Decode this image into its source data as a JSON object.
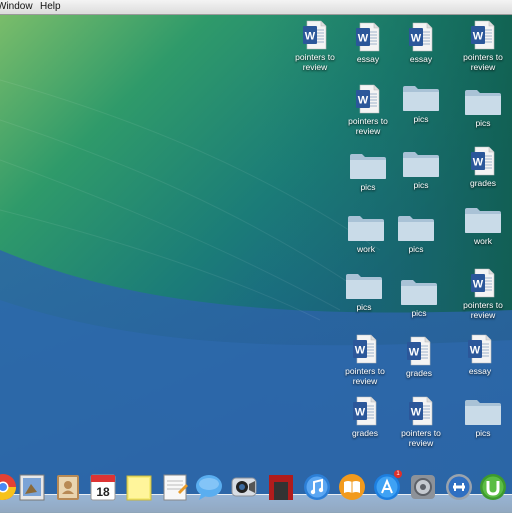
{
  "menubar": {
    "items": [
      "Window",
      "Help"
    ],
    "visible_items": [
      "Window",
      "Help"
    ]
  },
  "desktop": {
    "icons": [
      {
        "type": "word",
        "label": "pointers to review"
      },
      {
        "type": "word",
        "label": "essay"
      },
      {
        "type": "word",
        "label": "essay"
      },
      {
        "type": "word",
        "label": "pointers to review"
      },
      {
        "type": "word",
        "label": "pointers to review"
      },
      {
        "type": "folder",
        "label": "pics"
      },
      {
        "type": "folder",
        "label": "pics"
      },
      {
        "type": "folder",
        "label": "pics"
      },
      {
        "type": "folder",
        "label": "pics"
      },
      {
        "type": "word",
        "label": "grades"
      },
      {
        "type": "folder",
        "label": "work"
      },
      {
        "type": "folder",
        "label": "pics"
      },
      {
        "type": "folder",
        "label": "work"
      },
      {
        "type": "folder",
        "label": "pics"
      },
      {
        "type": "folder",
        "label": "pics"
      },
      {
        "type": "word",
        "label": "pointers to review"
      },
      {
        "type": "word",
        "label": "pointers to review"
      },
      {
        "type": "word",
        "label": "grades"
      },
      {
        "type": "word",
        "label": "essay"
      },
      {
        "type": "word",
        "label": "grades"
      },
      {
        "type": "word",
        "label": "pointers to review"
      },
      {
        "type": "folder",
        "label": "pics"
      }
    ]
  },
  "dock": {
    "items": [
      {
        "icon": "chrome-icon"
      },
      {
        "icon": "preview-icon"
      },
      {
        "icon": "contacts-icon"
      },
      {
        "icon": "calendar-icon",
        "text": "18"
      },
      {
        "icon": "stickies-icon"
      },
      {
        "icon": "textedit-icon"
      },
      {
        "icon": "messages-icon"
      },
      {
        "icon": "facetime-icon"
      },
      {
        "icon": "photo-booth-icon"
      },
      {
        "icon": "itunes-icon"
      },
      {
        "icon": "ibooks-icon"
      },
      {
        "icon": "app-store-icon",
        "badge": "1"
      },
      {
        "icon": "system-preferences-icon"
      },
      {
        "icon": "boot-camp-icon"
      },
      {
        "icon": "utorrent-icon"
      }
    ]
  },
  "colors": {
    "word_blue": "#2b579a",
    "folder_light": "#c9dbe8",
    "folder_dark": "#a9c2d6"
  }
}
